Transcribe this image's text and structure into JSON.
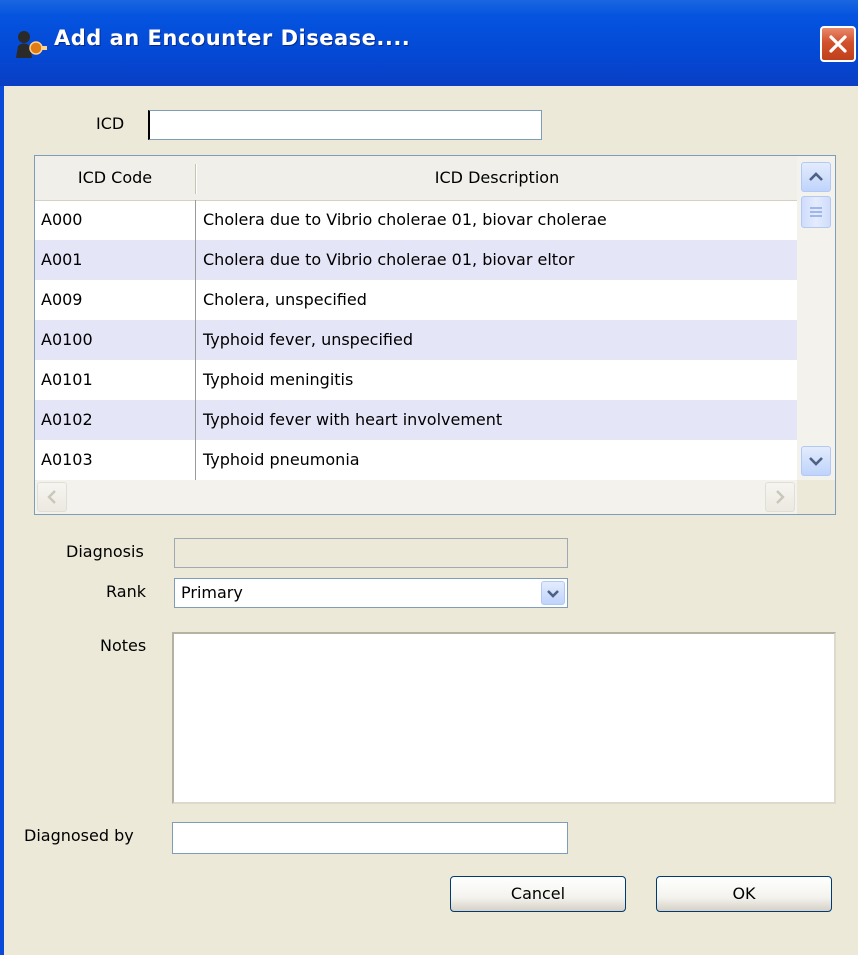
{
  "window": {
    "title": "Add an Encounter Disease...."
  },
  "icd": {
    "label": "ICD",
    "value": ""
  },
  "table": {
    "columns": [
      "ICD Code",
      "ICD Description"
    ],
    "rows": [
      {
        "code": "A000",
        "description": "Cholera due to Vibrio cholerae 01, biovar cholerae"
      },
      {
        "code": "A001",
        "description": "Cholera due to Vibrio cholerae 01, biovar eltor"
      },
      {
        "code": "A009",
        "description": "Cholera, unspecified"
      },
      {
        "code": "A0100",
        "description": "Typhoid fever, unspecified"
      },
      {
        "code": "A0101",
        "description": "Typhoid meningitis"
      },
      {
        "code": "A0102",
        "description": "Typhoid fever with heart involvement"
      },
      {
        "code": "A0103",
        "description": "Typhoid pneumonia"
      }
    ]
  },
  "diagnosis": {
    "label": "Diagnosis",
    "value": ""
  },
  "rank": {
    "label": "Rank",
    "value": "Primary"
  },
  "notes": {
    "label": "Notes",
    "value": ""
  },
  "diagnosed_by": {
    "label": "Diagnosed by",
    "value": ""
  },
  "buttons": {
    "cancel": "Cancel",
    "ok": "OK"
  },
  "colors": {
    "titlebar": "#0349d6",
    "window_bg": "#ECE9D8",
    "alt_row": "#E5E5F8",
    "close_button": "#d2512d"
  }
}
